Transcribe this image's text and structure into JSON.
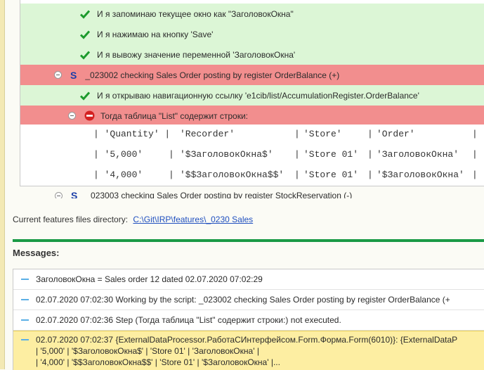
{
  "results": {
    "steps": [
      {
        "text": "И я запоминаю текущее окно как \"ЗаголовокОкна\""
      },
      {
        "text": "И я нажимаю на кнопку 'Save'"
      },
      {
        "text": "И я вывожу значение переменной 'ЗаголовокОкна'"
      }
    ],
    "scenario_failed": {
      "marker": "S",
      "text": "_023002 checking Sales Order posting by register OrderBalance (+)"
    },
    "step_nav": {
      "text": "И я открываю навигационную ссылку 'e1cib/list/AccumulationRegister.OrderBalance'"
    },
    "step_failed": {
      "text": "Тогда таблица \"List\" содержит строки:"
    },
    "table_rows": [
      {
        "c0": "| 'Quantity' |",
        "c1": "'Recorder'",
        "c1sep": "|",
        "c2": "'Store'",
        "c2sep": "|",
        "c3": "'Order'",
        "c3sep": "|"
      },
      {
        "c0": "| '5,000'",
        "c0sep": "|",
        "c1": "'$ЗаголовокОкна$'",
        "c1sep": "|",
        "c2": "'Store 01'",
        "c2sep": "|",
        "c3": "'ЗаголовокОкна'",
        "c3sep": "|"
      },
      {
        "c0": "| '4,000'",
        "c0sep": "|",
        "c1": "'$$ЗаголовокОкна$$'",
        "c1sep": "|",
        "c2": "'Store 01'",
        "c2sep": "|",
        "c3": "'$ЗаголовокОкна'",
        "c3sep": "|"
      }
    ],
    "scenario_next": {
      "marker": "S",
      "text": "_023003 checking Sales Order posting by register StockReservation (-)"
    }
  },
  "directory": {
    "label": "Current features files directory:",
    "link": "C:\\Git\\IRP\\features\\_0230 Sales"
  },
  "messages": {
    "title": "Messages:",
    "items": [
      {
        "text": "ЗаголовокОкна = Sales order 12 dated 02.07.2020 07:02:29"
      },
      {
        "text": "02.07.2020 07:02:30 Working by the script: _023002 checking Sales Order posting by register OrderBalance (+"
      },
      {
        "text": "02.07.2020 07:02:36 Step (Тогда таблица \"List\" содержит строки:) not executed."
      }
    ],
    "warning": {
      "line1": "02.07.2020 07:02:37 {ExternalDataProcessor.РаботаСИнтерфейсом.Form.Форма.Form(6010)}: {ExternalDataP",
      "line2": "| '5,000' | '$ЗаголовокОкна$' | 'Store 01' | 'ЗаголовокОкна' |",
      "line3": "| '4,000' | '$$ЗаголовокОкна$$' | 'Store 01' | '$ЗаголовокОкна' |..."
    }
  },
  "colors": {
    "pass_row": "#dcf6d6",
    "fail_row": "#f28e8e",
    "accent_green": "#1a9a46",
    "link": "#1f4fbf",
    "warning_row": "#fdeea2"
  }
}
